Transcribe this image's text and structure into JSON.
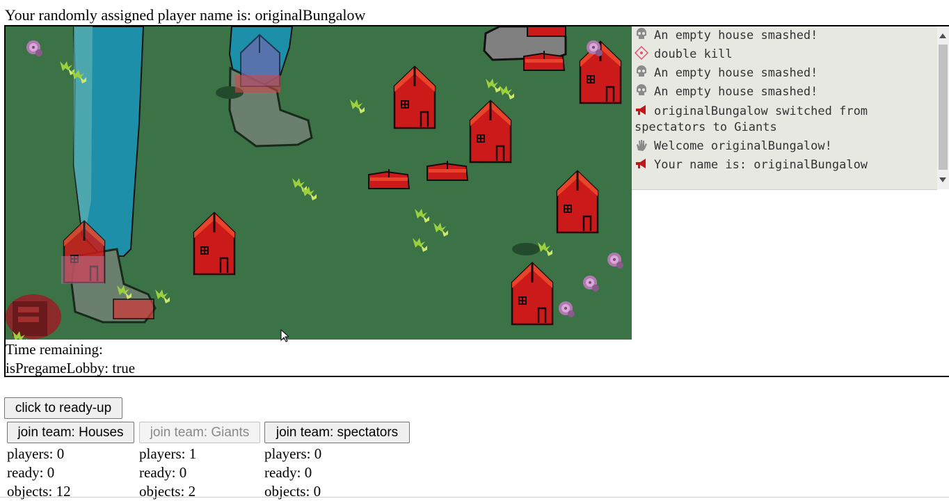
{
  "header": {
    "player_name_text": "Your randomly assigned player name is: originalBungalow"
  },
  "game": {
    "status": {
      "time_remaining": "Time remaining:",
      "is_pregame_lobby": "isPregameLobby: true"
    },
    "colors": {
      "grass": "#3b7347",
      "river": "#1e8fa8",
      "house_red": "#cc1a1a",
      "chat_bg": "#e8e8e3"
    }
  },
  "chat": {
    "messages": [
      {
        "icon": "skull-icon",
        "text": "An empty house smashed!"
      },
      {
        "icon": "target-icon",
        "text": "double kill"
      },
      {
        "icon": "skull-icon",
        "text": "An empty house smashed!"
      },
      {
        "icon": "skull-icon",
        "text": "An empty house smashed!"
      },
      {
        "icon": "megaphone-icon",
        "text": "originalBungalow switched from spectators to Giants"
      },
      {
        "icon": "wave-hand-icon",
        "text": "Welcome originalBungalow!"
      },
      {
        "icon": "megaphone-icon",
        "text": "Your name is: originalBungalow"
      }
    ]
  },
  "controls": {
    "ready_label": "click to ready-up",
    "teams": [
      {
        "label": "join team: Houses",
        "players": "players: 0",
        "ready": "ready: 0",
        "objects": "objects: 12"
      },
      {
        "label": "join team: Giants",
        "players": "players: 1",
        "ready": "ready: 0",
        "objects": "objects: 2"
      },
      {
        "label": "join team: spectators",
        "players": "players: 0",
        "ready": "ready: 0",
        "objects": "objects: 0"
      }
    ]
  }
}
